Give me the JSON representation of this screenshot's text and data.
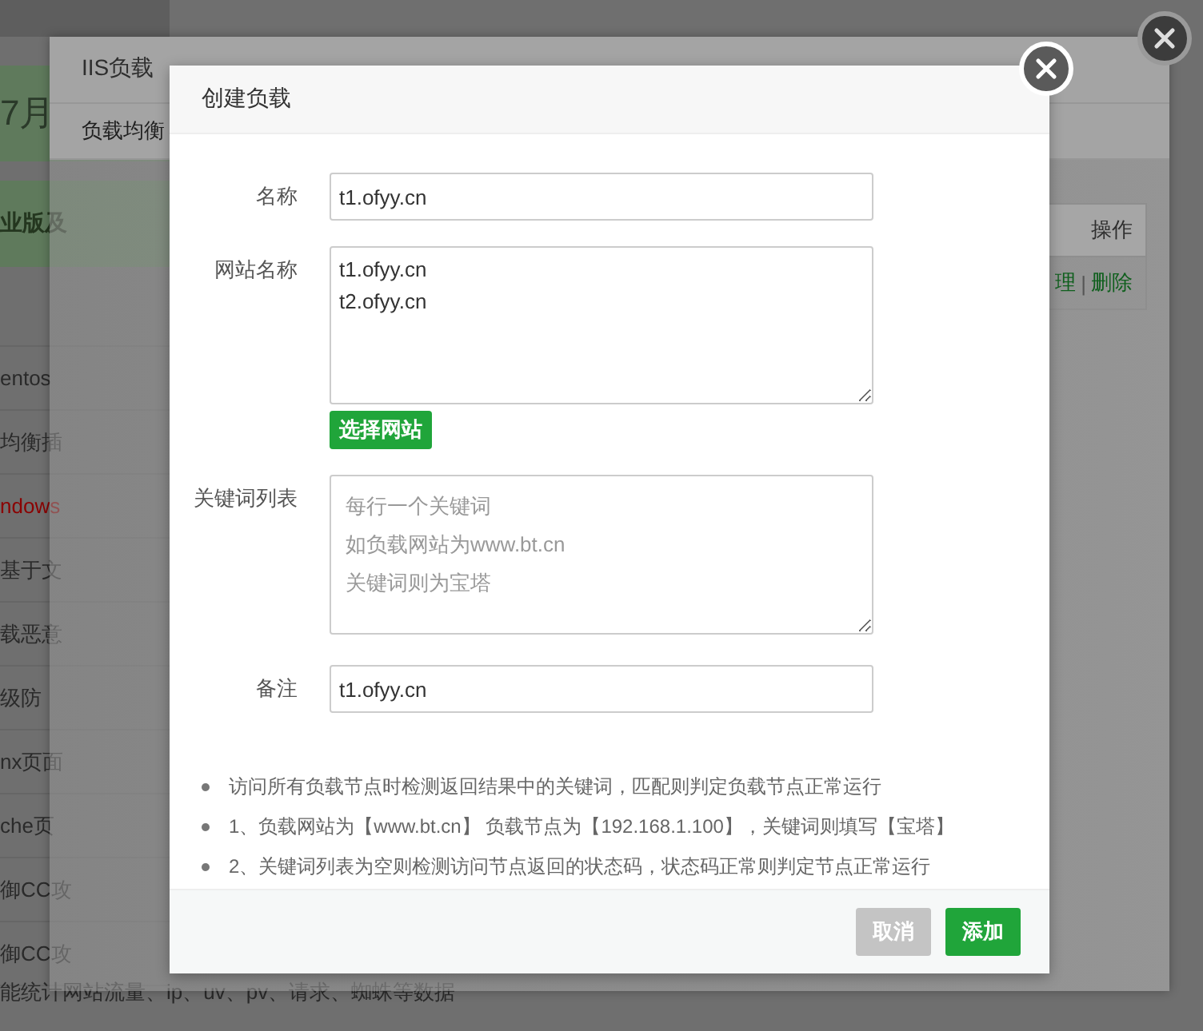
{
  "page": {
    "banner_1": "7月",
    "banner_2": "业版及",
    "left_items": [
      {
        "text": "entos",
        "color": "#2a2a2a"
      },
      {
        "text": "均衡插",
        "color": "#2a2a2a"
      },
      {
        "text": "ndows",
        "color": "#8b0000"
      },
      {
        "text": "基于文",
        "color": "#2a2a2a"
      },
      {
        "text": "载恶意",
        "color": "#2a2a2a"
      },
      {
        "text": "级防",
        "color": "#2a2a2a"
      },
      {
        "text": "nx页面",
        "color": "#2a2a2a"
      },
      {
        "text": "che页",
        "color": "#2a2a2a"
      },
      {
        "text": "御CC攻",
        "color": "#2a2a2a"
      },
      {
        "text": "御CC攻",
        "color": "#2a2a2a"
      }
    ],
    "footer_text": "能统计网站流量、ip、uv、pv、请求、蜘蛛等数据"
  },
  "plugin_window": {
    "title": "IIS负载",
    "tabs": [
      {
        "label": "负载均衡",
        "selected": true
      }
    ],
    "table": {
      "header": "操作",
      "actions": [
        "理",
        "删除"
      ],
      "separator": "|"
    }
  },
  "dialog": {
    "title": "创建负载",
    "fields": [
      {
        "kind": "input",
        "label": "名称",
        "value": "t1.ofyy.cn"
      },
      {
        "kind": "textarea",
        "label": "网站名称",
        "value": "t1.ofyy.cn\nt2.ofyy.cn",
        "button": "选择网站"
      },
      {
        "kind": "textarea",
        "label": "关键词列表",
        "placeholder": [
          "每行一个关键词",
          "如负载网站为www.bt.cn",
          "关键词则为宝塔"
        ]
      },
      {
        "kind": "input",
        "label": "备注",
        "value": "t1.ofyy.cn"
      }
    ],
    "notes": [
      "访问所有负载节点时检测返回结果中的关键词，匹配则判定负载节点正常运行",
      "1、负载网站为【www.bt.cn】 负载节点为【192.168.1.100】，关键词则填写【宝塔】",
      "2、关键词列表为空则检测访问节点返回的状态码，状态码正常则判定节点正常运行"
    ],
    "buttons": [
      {
        "label": "取消",
        "disabled": true
      },
      {
        "label": "添加",
        "disabled": false
      }
    ]
  }
}
